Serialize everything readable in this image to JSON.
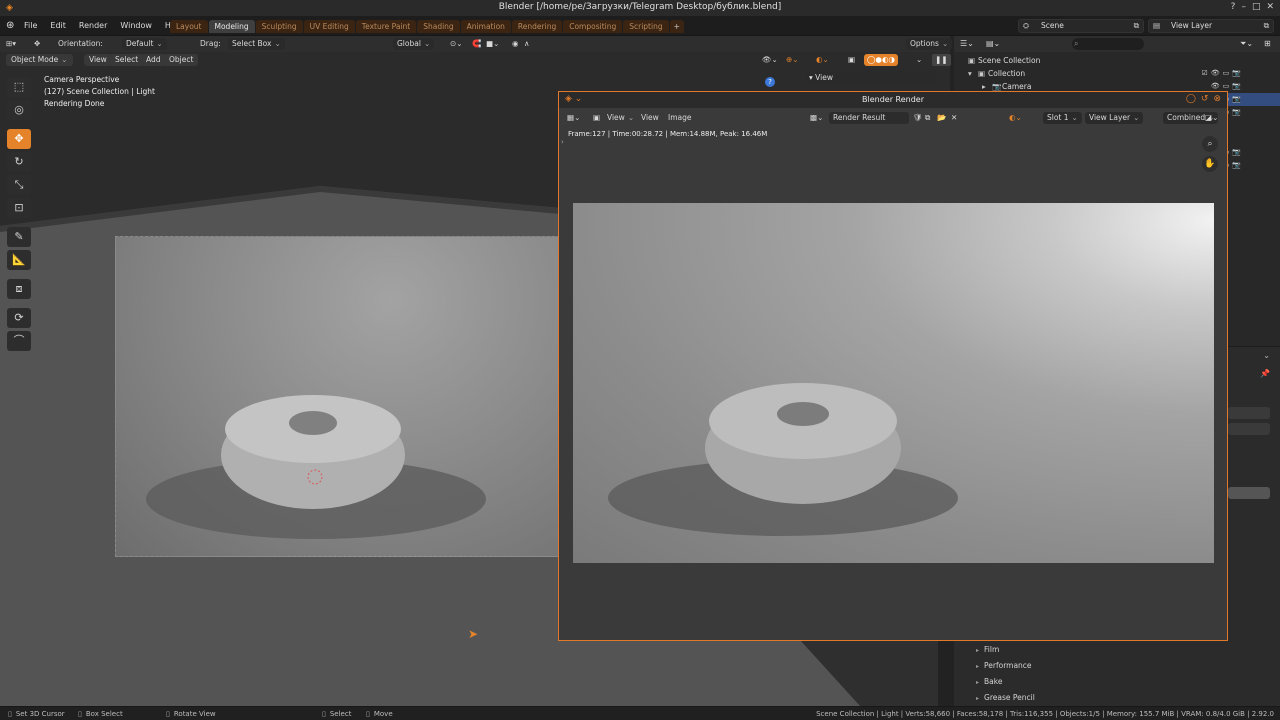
{
  "window": {
    "title": "Blender [/home/pe/Загрузки/Telegram Desktop/бублик.blend]"
  },
  "menu": [
    "File",
    "Edit",
    "Render",
    "Window",
    "Help"
  ],
  "workspace_tabs": [
    "Layout",
    "Modeling",
    "Sculpting",
    "UV Editing",
    "Texture Paint",
    "Shading",
    "Animation",
    "Rendering",
    "Compositing",
    "Scripting"
  ],
  "active_workspace": "Modeling",
  "scene": {
    "label": "Scene",
    "view_layer": "View Layer"
  },
  "viewport_header": {
    "orientation_label": "Orientation:",
    "orientation_value": "Default",
    "drag_label": "Drag:",
    "drag_value": "Select Box",
    "transform_orientation": "Global",
    "options_label": "Options"
  },
  "viewport_header2": {
    "mode": "Object Mode",
    "menus": [
      "View",
      "Select",
      "Add",
      "Object"
    ],
    "view_dropdown": "View"
  },
  "viewport_overlay": {
    "line1": "Camera Perspective",
    "line2": "(127) Scene Collection | Light",
    "line3": "Rendering Done"
  },
  "render_window": {
    "title": "Blender Render",
    "menus": [
      "View",
      "View",
      "Image"
    ],
    "result_name": "Render Result",
    "slot": "Slot 1",
    "view_layer": "View Layer",
    "pass": "Combined",
    "stats": "Frame:127 | Time:00:28.72 | Mem:14.88M, Peak: 16.46M"
  },
  "outliner": {
    "search_placeholder": "",
    "rows": [
      {
        "label": "Scene Collection",
        "icon": "collection-icon"
      },
      {
        "label": "Collection",
        "icon": "collection-icon"
      },
      {
        "label": "Camera",
        "icon": "camera-icon"
      }
    ]
  },
  "properties": {
    "sections": [
      "Film",
      "Performance",
      "Bake",
      "Grease Pencil"
    ]
  },
  "statusbar": {
    "left": [
      "Set 3D Cursor",
      "Box Select",
      "Rotate View"
    ],
    "middle": [
      "Select",
      "Move"
    ],
    "right": "Scene Collection | Light | Verts:58,660 | Faces:58,178 | Tris:116,355 | Objects:1/5 | Memory: 155.7 MiB | VRAM: 0.8/4.0 GiB | 2.92.0"
  },
  "colors": {
    "accent": "#e5832a",
    "selection": "#334d80",
    "tab_inactive": "#3b2411"
  }
}
